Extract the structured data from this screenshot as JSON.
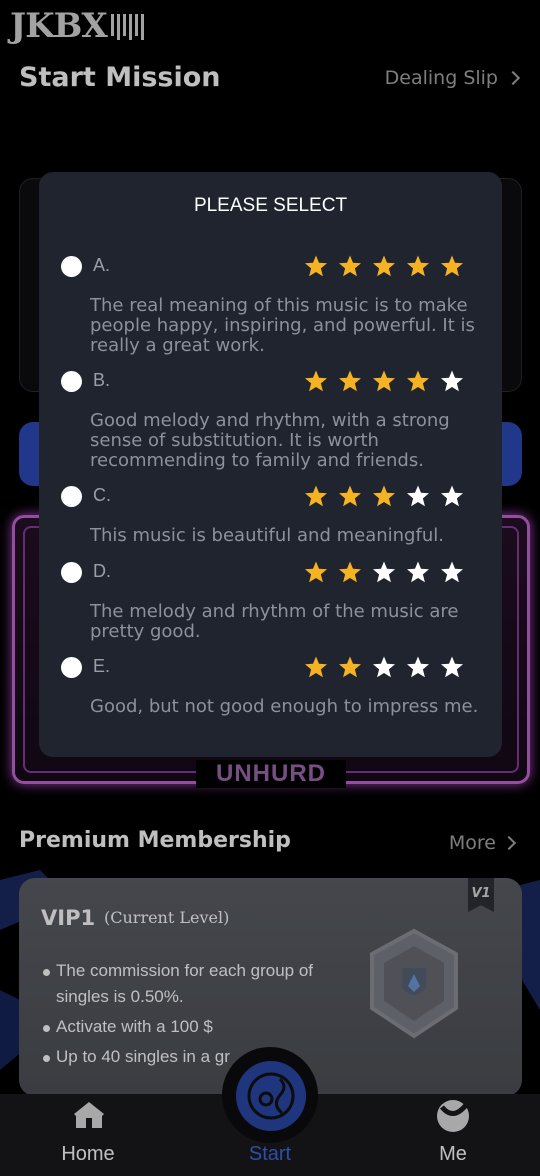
{
  "app": {
    "logo_text": "JKBX"
  },
  "header": {
    "title": "Start Mission",
    "link_label": "Dealing Slip"
  },
  "banner": {
    "brand_text": "UNHURD"
  },
  "premium": {
    "title": "Premium Membership",
    "more_label": "More"
  },
  "vip": {
    "name": "VIP1",
    "level_label": "(Current Level)",
    "corner_badge": "V1",
    "bullets": [
      "The commission for each group of singles is 0.50%.",
      "Activate with a 100 $",
      "Up to 40 singles in a gr"
    ]
  },
  "tabs": [
    {
      "label": "Home",
      "icon": "home-icon"
    },
    {
      "label": "Start",
      "icon": "music-disc-icon"
    },
    {
      "label": "Me",
      "icon": "profile-icon"
    }
  ],
  "colors": {
    "star_filled": "#f5b324",
    "star_empty": "#ffffff",
    "active_tab": "#3e6ae0",
    "modal_bg": "#20242f"
  },
  "modal": {
    "title": "PLEASE SELECT",
    "options": [
      {
        "letter": "A.",
        "stars": 5,
        "text": "The real meaning of this music is to make people happy, inspiring, and powerful. It is really a great work."
      },
      {
        "letter": "B.",
        "stars": 4,
        "text": "Good melody and rhythm, with a strong sense of substitution. It is worth recommending to family and friends."
      },
      {
        "letter": "C.",
        "stars": 3,
        "text": "This music is beautiful and meaningful."
      },
      {
        "letter": "D.",
        "stars": 2,
        "text": "The melody and rhythm of the music are pretty good."
      },
      {
        "letter": "E.",
        "stars": 2,
        "text": "Good, but not good enough to impress me."
      }
    ]
  }
}
